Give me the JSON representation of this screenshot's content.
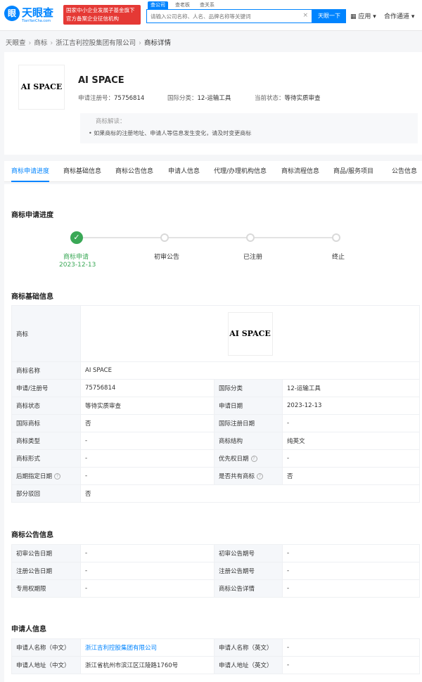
{
  "header": {
    "logo_mark": "眼",
    "logo_text": "天眼查",
    "logo_sub": "TianYanCha.com",
    "badge_line1": "国家中小企业发展子基金旗下",
    "badge_line2": "官方备案企业征信机构",
    "search_tabs": [
      "查公司",
      "查老板",
      "查关系"
    ],
    "search_placeholder": "请输入公司名称、人名、品牌名称等关键词",
    "search_button": "天眼一下",
    "apps_label": "应用",
    "coop_label": "合作通道",
    "accent": "#0084ff"
  },
  "breadcrumb": [
    "天眼查",
    "商标",
    "浙江吉利控股集团有限公司",
    "商标详情"
  ],
  "summary": {
    "logo_text": "AI SPACE",
    "name": "AI SPACE",
    "reg_no_label": "申请注册号：",
    "reg_no": "75756814",
    "class_label": "国际分类：",
    "class_value": "12-运输工具",
    "status_label": "当前状态：",
    "status_value": "等待实质审查",
    "note_title": "商标解读：",
    "note_body": "• 如果商标的注册地址、申请人等信息发生变化，请及时变更商标"
  },
  "tabs": [
    "商标申请进度",
    "商标基础信息",
    "商标公告信息",
    "申请人信息",
    "代理/办理机构信息",
    "商标流程信息",
    "商品/服务项目",
    "公告信息"
  ],
  "progress": {
    "title": "商标申请进度",
    "steps": [
      "商标申请",
      "初审公告",
      "已注册",
      "终止"
    ],
    "done_date": "2023-12-13",
    "done_color": "#3aa856"
  },
  "basic": {
    "title": "商标基础信息",
    "logo_label": "商标",
    "logo_text": "AI SPACE",
    "name_label": "商标名称",
    "name_value": "AI SPACE",
    "rows": [
      [
        "申请/注册号",
        "75756814",
        "国际分类",
        "12-运输工具"
      ],
      [
        "商标状态",
        "等待实质审查",
        "申请日期",
        "2023-12-13"
      ],
      [
        "国际商标",
        "否",
        "国际注册日期",
        "-"
      ],
      [
        "商标类型",
        "-",
        "商标结构",
        "纯英文"
      ],
      [
        "商标形式",
        "-",
        "优先权日期",
        "-"
      ],
      [
        "后期指定日期",
        "-",
        "是否共有商标",
        "否"
      ]
    ],
    "partial_label": "部分驳回",
    "partial_value": "否"
  },
  "notice": {
    "title": "商标公告信息",
    "rows": [
      [
        "初审公告日期",
        "-",
        "初审公告期号",
        "-"
      ],
      [
        "注册公告日期",
        "-",
        "注册公告期号",
        "-"
      ],
      [
        "专用权期限",
        "-",
        "商标公告详情",
        "-"
      ]
    ]
  },
  "applicant": {
    "title": "申请人信息",
    "rows": [
      [
        "申请人名称（中文）",
        "浙江吉利控股集团有限公司",
        "申请人名称（英文）",
        "-"
      ],
      [
        "申请人地址（中文）",
        "浙江省杭州市滨江区江陵路1760号",
        "申请人地址（英文）",
        "-"
      ]
    ]
  }
}
